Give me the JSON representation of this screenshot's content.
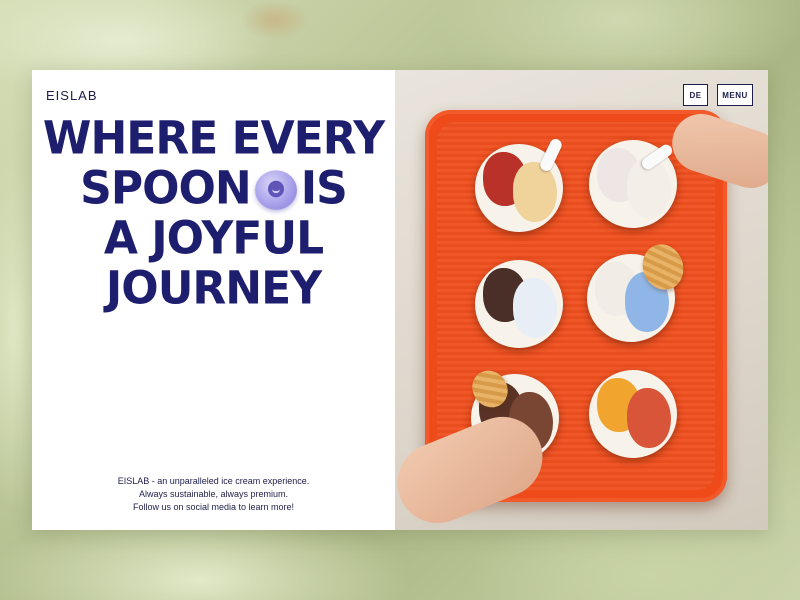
{
  "brand": {
    "logo": "EISLAB"
  },
  "header": {
    "lang_label": "DE",
    "menu_label": "MENU"
  },
  "hero": {
    "line1": "WHERE EVERY",
    "line2_a": "SPOON",
    "line2_b": "IS",
    "line3": "A JOYFUL",
    "line4": "JOURNEY",
    "badge_icon": "smiley-spoon-icon"
  },
  "tagline": {
    "line1": "EISLAB - an unparalleled ice cream experience.",
    "line2": "Always sustainable, always premium.",
    "line3": "Follow us on social media to learn more!"
  },
  "colors": {
    "brand_navy": "#1e1e6e",
    "tray_orange": "#ef4a1a",
    "badge_lilac": "#a9a1ea",
    "background_pistachio": "#b7c293"
  }
}
